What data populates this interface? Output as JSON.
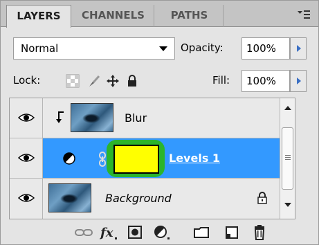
{
  "tabs": [
    {
      "label": "LAYERS"
    },
    {
      "label": "CHANNELS"
    },
    {
      "label": "PATHS"
    }
  ],
  "blend_mode": {
    "value": "Normal"
  },
  "opacity": {
    "label": "Opacity:",
    "value": "100%"
  },
  "lock": {
    "label": "Lock:"
  },
  "fill": {
    "label": "Fill:",
    "value": "100%"
  },
  "layers": [
    {
      "name": "Blur",
      "type": "clipped-pixel"
    },
    {
      "name": "Levels 1",
      "type": "adjustment",
      "selected": true
    },
    {
      "name": "Background",
      "type": "background-locked"
    }
  ],
  "colors": {
    "selection": "#3399ff",
    "mask_highlight": "#ffff00",
    "mask_outline": "#2bb52b"
  },
  "icons": [
    "panel-menu-icon",
    "transparency-lock-icon",
    "brush-lock-icon",
    "move-lock-icon",
    "all-lock-icon",
    "eye-icon",
    "clip-arrow-icon",
    "adjustment-icon",
    "chain-icon",
    "padlock-icon",
    "link-layers-icon",
    "fx-icon",
    "add-mask-icon",
    "new-adjustment-icon",
    "new-group-icon",
    "new-layer-icon",
    "trash-icon"
  ]
}
